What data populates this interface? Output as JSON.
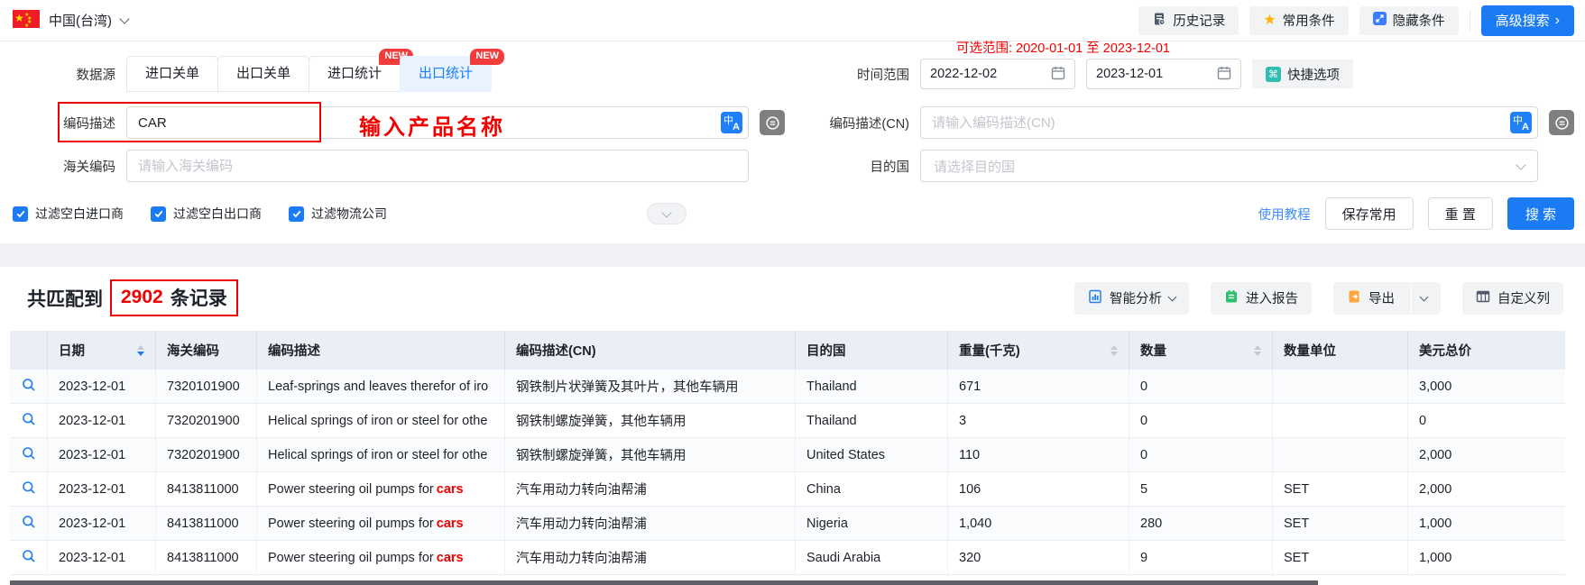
{
  "colors": {
    "primary_blue": "#1b7bf5",
    "annotation_red": "#f20000",
    "badge_red": "#f23c3c",
    "star_yellow": "#ffb400",
    "table_header_bg": "#e9eef7"
  },
  "topbar": {
    "region": "中国(台湾)",
    "history": "历史记录",
    "favorites": "常用条件",
    "hide_conditions": "隐藏条件",
    "advanced_search": "高级搜索"
  },
  "filters": {
    "datasource_label": "数据源",
    "tabs": [
      {
        "label": "进口关单",
        "badge": ""
      },
      {
        "label": "出口关单",
        "badge": ""
      },
      {
        "label": "进口统计",
        "badge": "NEW"
      },
      {
        "label": "出口统计",
        "badge": "NEW"
      }
    ],
    "time_range": {
      "label": "时间范围",
      "hint": "可选范围: 2020-01-01 至 2023-12-01",
      "start": "2022-12-02",
      "end": "2023-12-01",
      "quick": "快捷选项"
    },
    "code_desc": {
      "label": "编码描述",
      "value": "CAR",
      "annotation": "输入产品名称"
    },
    "code_desc_cn": {
      "label": "编码描述(CN)",
      "placeholder": "请输入编码描述(CN)"
    },
    "hs_code": {
      "label": "海关编码",
      "placeholder": "请输入海关编码"
    },
    "destination": {
      "label": "目的国",
      "placeholder": "请选择目的国"
    },
    "checkboxes": [
      {
        "label": "过滤空白进口商",
        "checked": true
      },
      {
        "label": "过滤空白出口商",
        "checked": true
      },
      {
        "label": "过滤物流公司",
        "checked": true
      }
    ],
    "tutorial": "使用教程",
    "save": "保存常用",
    "reset": "重 置",
    "search": "搜 索"
  },
  "results": {
    "summary_prefix": "共匹配到",
    "summary_count": "2902",
    "summary_suffix": "条记录",
    "analysis": "智能分析",
    "report": "进入报告",
    "export": "导出",
    "custom_columns": "自定义列"
  },
  "table": {
    "columns": [
      "",
      "日期",
      "海关编码",
      "编码描述",
      "编码描述(CN)",
      "目的国",
      "重量(千克)",
      "数量",
      "数量单位",
      "美元总价"
    ],
    "rows": [
      {
        "date": "2023-12-01",
        "hs_code": "7320101900",
        "desc": "Leaf-springs and leaves therefor of iro",
        "desc_highlight": "",
        "desc_cn": "钢铁制片状弹簧及其叶片，其他车辆用",
        "country": "Thailand",
        "weight": "671",
        "qty": "0",
        "unit": "",
        "total": "3,000"
      },
      {
        "date": "2023-12-01",
        "hs_code": "7320201900",
        "desc": "Helical springs of iron or steel for othe",
        "desc_highlight": "",
        "desc_cn": "钢铁制螺旋弹簧，其他车辆用",
        "country": "Thailand",
        "weight": "3",
        "qty": "0",
        "unit": "",
        "total": "0"
      },
      {
        "date": "2023-12-01",
        "hs_code": "7320201900",
        "desc": "Helical springs of iron or steel for othe",
        "desc_highlight": "",
        "desc_cn": "钢铁制螺旋弹簧，其他车辆用",
        "country": "United States",
        "weight": "110",
        "qty": "0",
        "unit": "",
        "total": "2,000"
      },
      {
        "date": "2023-12-01",
        "hs_code": "8413811000",
        "desc": "Power steering oil pumps for",
        "desc_highlight": "cars",
        "desc_cn": "汽车用动力转向油帮浦",
        "country": "China",
        "weight": "106",
        "qty": "5",
        "unit": "SET",
        "total": "2,000"
      },
      {
        "date": "2023-12-01",
        "hs_code": "8413811000",
        "desc": "Power steering oil pumps for",
        "desc_highlight": "cars",
        "desc_cn": "汽车用动力转向油帮浦",
        "country": "Nigeria",
        "weight": "1,040",
        "qty": "280",
        "unit": "SET",
        "total": "1,000"
      },
      {
        "date": "2023-12-01",
        "hs_code": "8413811000",
        "desc": "Power steering oil pumps for",
        "desc_highlight": "cars",
        "desc_cn": "汽车用动力转向油帮浦",
        "country": "Saudi Arabia",
        "weight": "320",
        "qty": "9",
        "unit": "SET",
        "total": "1,000"
      }
    ]
  }
}
